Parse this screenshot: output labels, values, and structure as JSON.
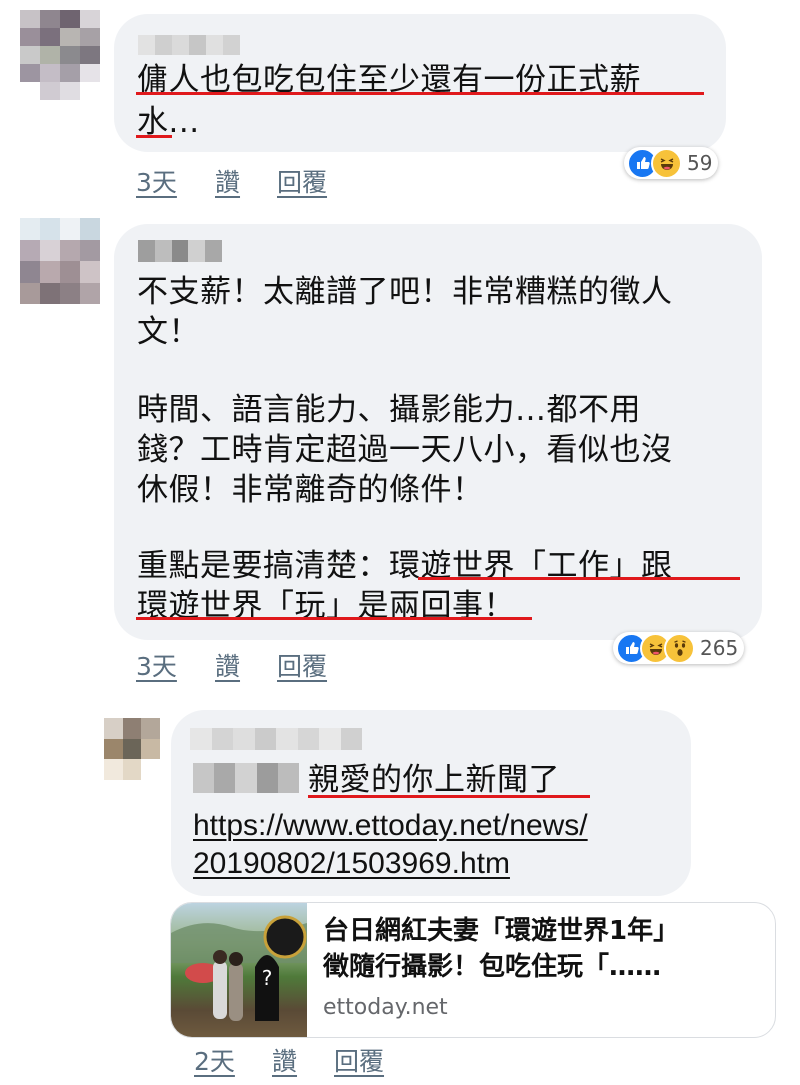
{
  "comments": [
    {
      "text_lines": [
        "傭人也包吃包住至少還有一份正式薪",
        "水..."
      ],
      "time": "3天",
      "like": "讚",
      "reply": "回覆",
      "reactions": {
        "icons": [
          "like-icon",
          "haha-icon"
        ],
        "count": "59"
      }
    },
    {
      "text_lines": [
        "不支薪！太離譜了吧！非常糟糕的徵人",
        "文！",
        "",
        "時間、語言能力、攝影能力…都不用",
        "錢？工時肯定超過一天八小，看似也沒",
        "休假！非常離奇的條件！",
        "",
        "重點是要搞清楚：環遊世界「工作」跟",
        "環遊世界「玩」是兩回事！"
      ],
      "time": "3天",
      "like": "讚",
      "reply": "回覆",
      "reactions": {
        "icons": [
          "like-icon",
          "haha-icon",
          "wow-icon"
        ],
        "count": "265"
      }
    }
  ],
  "reply": {
    "mention_text": "親愛的你上新聞了",
    "link_lines": [
      "https://www.ettoday.net/news/",
      "20190802/1503969.htm"
    ],
    "preview": {
      "title_lines": [
        "台日網紅夫妻「環遊世界1年」",
        "徵隨行攝影！包吃住玩「……"
      ],
      "domain": "ettoday.net"
    },
    "time": "2天",
    "like": "讚",
    "reply": "回覆"
  },
  "colors": {
    "bubble": "#f0f2f5",
    "underline_red": "#e0191c",
    "like_blue": "#1877f2",
    "emoji_yellow": "#f7c23a",
    "meta_text": "#5a6e7f"
  }
}
